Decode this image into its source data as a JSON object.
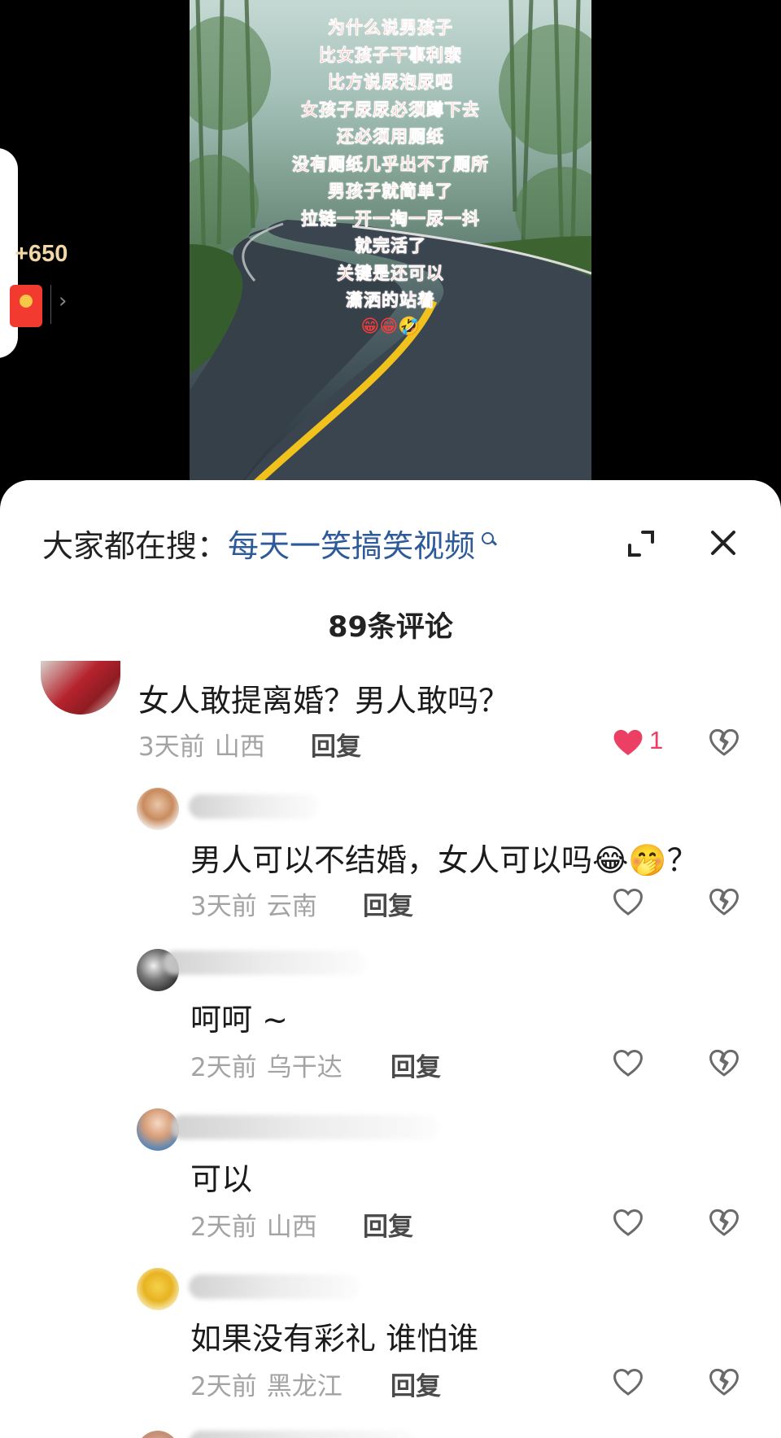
{
  "video": {
    "caption_lines": [
      "为什么说男孩子",
      "比女孩子干事利索",
      "比方说尿泡尿吧",
      "女孩子尿尿必须蹲下去",
      "还必须用厕纸",
      "没有厕纸几乎出不了厕所",
      "男孩子就简单了",
      "拉链一开一掏一尿一抖",
      "就完活了",
      "关键是还可以",
      "潇洒的站着"
    ],
    "caption_emoji": "😁😁🤣"
  },
  "side_panel": {
    "coin_reward": "+650",
    "chevron": "›"
  },
  "comment_sheet": {
    "search_prefix": "大家都在搜：",
    "search_term": "每天一笑搞笑视频",
    "count_label": "89条评论"
  },
  "comments": [
    {
      "text": "女人敢提离婚？男人敢吗？",
      "time": "3天前",
      "location": "山西",
      "reply": "回复",
      "likes": "1",
      "liked": true
    },
    {
      "text": "男人可以不结婚，女人可以吗😂🤭？",
      "time": "3天前",
      "location": "云南",
      "reply": "回复"
    },
    {
      "text": "呵呵 ~",
      "time": "2天前",
      "location": "乌干达",
      "reply": "回复"
    },
    {
      "text": "可以",
      "time": "2天前",
      "location": "山西",
      "reply": "回复"
    },
    {
      "text": "如果没有彩礼 谁怕谁",
      "time": "2天前",
      "location": "黑龙江",
      "reply": "回复"
    }
  ],
  "colors": {
    "accent_link": "#2d5a9a",
    "liked_heart": "#ec3f64",
    "caption_red": "#ff3b3b"
  },
  "icons": [
    "search-icon",
    "expand-icon",
    "close-icon",
    "heart-icon",
    "broken-heart-icon",
    "red-packet-icon",
    "chevron-right-icon"
  ]
}
